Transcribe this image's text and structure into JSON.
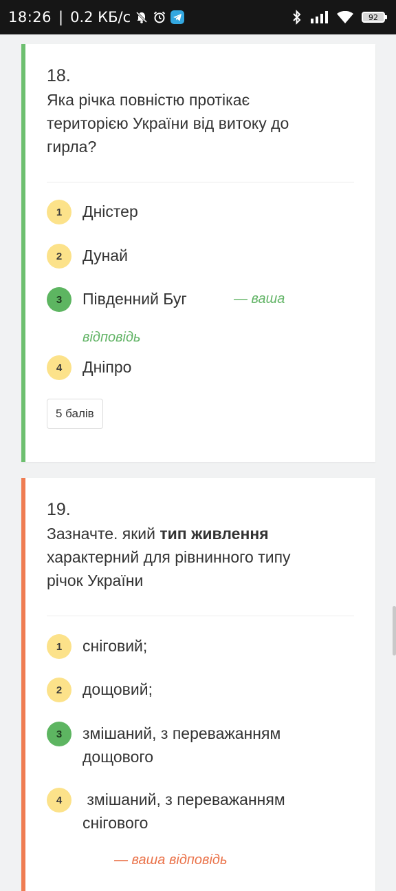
{
  "status_bar": {
    "time": "18:26",
    "separator": "|",
    "net_speed": "0.2 КБ/с",
    "battery": "92"
  },
  "questions": [
    {
      "number": "18.",
      "text": "Яка річка повністю протікає територією України від витоку до гирла?",
      "options": [
        {
          "num": "1",
          "text": "Дністер"
        },
        {
          "num": "2",
          "text": "Дунай"
        },
        {
          "num": "3",
          "text": "Південний Буг"
        },
        {
          "num": "4",
          "text": "Дніпро"
        }
      ],
      "your_answer_label": "— ваша відповідь",
      "points": "5 балів"
    },
    {
      "number": "19.",
      "text_part1": "Зазначте. який ",
      "text_bold": "тип живлення",
      "text_part2": " характерний для рівнинного типу річок України",
      "options": [
        {
          "num": "1",
          "text": "сніговий;"
        },
        {
          "num": "2",
          "text": "дощовий;"
        },
        {
          "num": "3",
          "text": "змішаний, з переважанням дощового"
        },
        {
          "num": "4",
          "text": " змішаний, з переважанням снігового"
        }
      ],
      "your_answer_label": "— ваша відповідь"
    }
  ],
  "colors": {
    "correct": "#6dbf6f",
    "incorrect": "#ef7c52",
    "badge": "#fce28a",
    "badge_selected": "#5db561"
  },
  "icons": [
    "silent-bell-icon",
    "alarm-icon",
    "telegram-icon",
    "bluetooth-icon",
    "signal-icon",
    "wifi-icon",
    "battery-icon"
  ]
}
